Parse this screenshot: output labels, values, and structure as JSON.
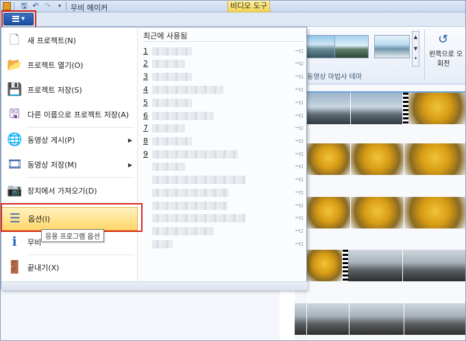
{
  "titlebar": {
    "app_title": "무비 메이커",
    "context_tab": "비디오 도구",
    "qat_icons": [
      "save-icon",
      "undo-icon",
      "redo-icon",
      "customize-icon"
    ]
  },
  "file_button": {
    "label": "▾"
  },
  "ribbon": {
    "group_label": "동영상 마법사 테마",
    "rotate_label_1": "왼쪽으로 오",
    "rotate_label_2": "회전"
  },
  "menu": {
    "items": [
      {
        "label": "새 프로젝트(N)",
        "icon": "new-project-icon"
      },
      {
        "label": "프로젝트 열기(O)",
        "icon": "open-folder-icon"
      },
      {
        "label": "프로젝트 저장(S)",
        "icon": "save-disk-icon"
      },
      {
        "label": "다른 이름으로 프로젝트 저장(A)",
        "icon": "save-as-icon"
      },
      {
        "label": "동영상 게시(P)",
        "icon": "globe-publish-icon"
      },
      {
        "label": "동영상 저장(M)",
        "icon": "film-save-icon"
      },
      {
        "label": "장치에서 가져오기(D)",
        "icon": "camera-import-icon"
      },
      {
        "label": "옵션(I)",
        "icon": "options-list-icon"
      },
      {
        "label": "무비",
        "icon": "info-icon"
      },
      {
        "label": "끝내기(X)",
        "icon": "exit-icon"
      }
    ],
    "tooltip": "응용 프로그램 옵션",
    "recent_title": "최근에 사용됨",
    "recent_numbers": [
      "1",
      "2",
      "3",
      "4",
      "5",
      "6",
      "7",
      "8",
      "9"
    ]
  },
  "colors": {
    "accent_blue": "#1d4e9e",
    "highlight_red": "#d9261c",
    "context_yellow": "#f2d45b"
  }
}
